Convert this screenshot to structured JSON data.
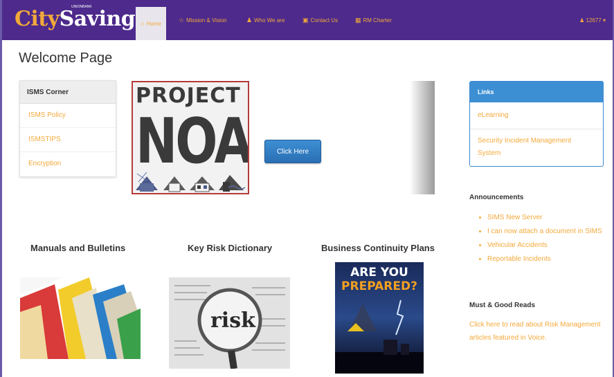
{
  "navbar": {
    "brand_city": "City",
    "brand_savings": "Savings",
    "brand_tag": "UNIONBANK",
    "items": [
      {
        "label": "Home",
        "icon": "home-icon",
        "glyph": "⌂",
        "active": true
      },
      {
        "label": "Mission & Vision",
        "icon": "star-icon",
        "glyph": "☆"
      },
      {
        "label": "Who We are",
        "icon": "user-icon",
        "glyph": "♟"
      },
      {
        "label": "Contact Us",
        "icon": "briefcase-icon",
        "glyph": "▣"
      },
      {
        "label": "RM Charter",
        "icon": "building-icon",
        "glyph": "▦"
      }
    ],
    "user_label": "12677 ▾"
  },
  "page_title": "Welcome Page",
  "isms": {
    "heading": "ISMS Corner",
    "items": [
      "ISMS Policy",
      "ISMSTIPS",
      "Encryption"
    ]
  },
  "banner": {
    "line1": "PROJECT",
    "line2": "NOAH"
  },
  "click_button": "Click Here",
  "links": {
    "heading": "Links",
    "items": [
      "eLearning",
      "Security Incident Management System"
    ]
  },
  "announcements": {
    "title": "Announcements",
    "items": [
      "SIMS New Server",
      "I can now attach a document in SIMS",
      "Vehicular Accidents",
      "Reportable Incidents"
    ]
  },
  "must_reads": {
    "title": "Must & Good Reads",
    "text": "Click here to read about Risk Management articles featured in Voice."
  },
  "sections": [
    {
      "title": "Manuals and Bulletins"
    },
    {
      "title": "Key Risk Dictionary",
      "image_word": "risk"
    },
    {
      "title": "Business Continuity Plans",
      "image_line1": "ARE YOU",
      "image_line2": "PREPARED?"
    }
  ],
  "colors": {
    "navbar": "#4d2a8c",
    "accent_orange": "#f3a93a",
    "link_blue": "#3d8fd4"
  }
}
